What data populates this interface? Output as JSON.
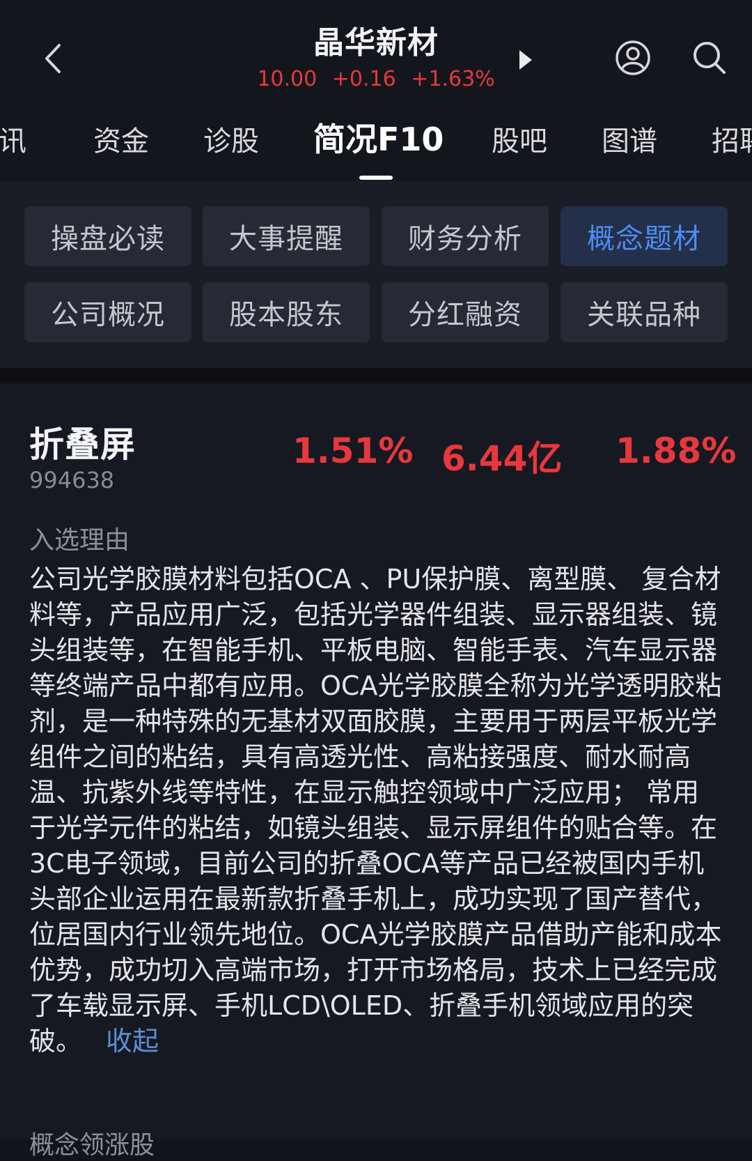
{
  "header": {
    "title": "晶华新材",
    "price": "10.00",
    "change": "+0.16",
    "change_pct": "+1.63%",
    "quote_color": "#e8383d"
  },
  "tabs": [
    "资讯",
    "资金",
    "诊股",
    "简况F10",
    "股吧",
    "图谱",
    "招聘"
  ],
  "active_tab": "简况F10",
  "sections": [
    {
      "label": "操盘必读",
      "active": false
    },
    {
      "label": "大事提醒",
      "active": false
    },
    {
      "label": "财务分析",
      "active": false
    },
    {
      "label": "概念题材",
      "active": true
    },
    {
      "label": "公司概况",
      "active": false
    },
    {
      "label": "股本股东",
      "active": false
    },
    {
      "label": "分红融资",
      "active": false
    },
    {
      "label": "关联品种",
      "active": false
    }
  ],
  "concept": {
    "name": "折叠屏",
    "code": "994638",
    "stat1": "1.51%",
    "stat2": "6.44亿",
    "stat3": "1.88%",
    "reason_label": "入选理由",
    "reason": "公司光学胶膜材料包括OCA 、PU保护膜、离型膜、 复合材料等，产品应用广泛，包括光学器件组装、显示器组装、镜头组装等，在智能手机、平板电脑、智能手表、汽车显示器等终端产品中都有应用。OCA光学胶膜全称为光学透明胶粘剂，是一种特殊的无基材双面胶膜，主要用于两层平板光学组件之间的粘结，具有高透光性、高粘接强度、耐水耐高温、抗紫外线等特性，在显示触控领域中广泛应用； 常用于光学元件的粘结，如镜头组装、显示屏组件的贴合等。在3C电子领域，目前公司的折叠OCA等产品已经被国内手机头部企业运用在最新款折叠手机上，成功实现了国产替代，位居国内行业领先地位。OCA光学胶膜产品借助产能和成本优势，成功切入高端市场，打开市场格局，技术上已经完成了车载显示屏、手机LCD\\OLED、折叠手机领域应用的突破。",
    "collapse_label": "收起"
  },
  "next_section_label": "概念领涨股",
  "colors": {
    "accent_red": "#e8383d",
    "accent_blue": "#4d8cf5",
    "background": "#12141b"
  }
}
